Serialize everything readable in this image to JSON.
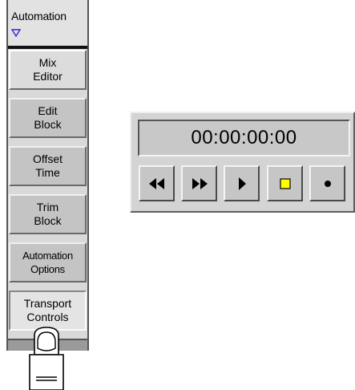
{
  "sidebar": {
    "header": {
      "title": "Automation",
      "dropdown_icon": "triangle-down-icon"
    },
    "items": [
      {
        "label": "Mix\nEditor",
        "state": "active"
      },
      {
        "label": "Edit\nBlock",
        "state": "normal"
      },
      {
        "label": "Offset\nTime",
        "state": "normal"
      },
      {
        "label": "Trim\nBlock",
        "state": "normal"
      },
      {
        "label": "Automation\nOptions",
        "state": "normal"
      },
      {
        "label": "Transport\nControls",
        "state": "pressed"
      }
    ]
  },
  "cursor": {
    "icon": "pointing-hand-icon"
  },
  "transport": {
    "timecode": "00:00:00:00",
    "buttons": [
      {
        "name": "rewind",
        "icon": "rewind-icon"
      },
      {
        "name": "fast-forward",
        "icon": "fast-forward-icon"
      },
      {
        "name": "play",
        "icon": "play-icon"
      },
      {
        "name": "stop",
        "icon": "stop-icon",
        "color": "#ffff00"
      },
      {
        "name": "record",
        "icon": "record-icon"
      }
    ]
  }
}
